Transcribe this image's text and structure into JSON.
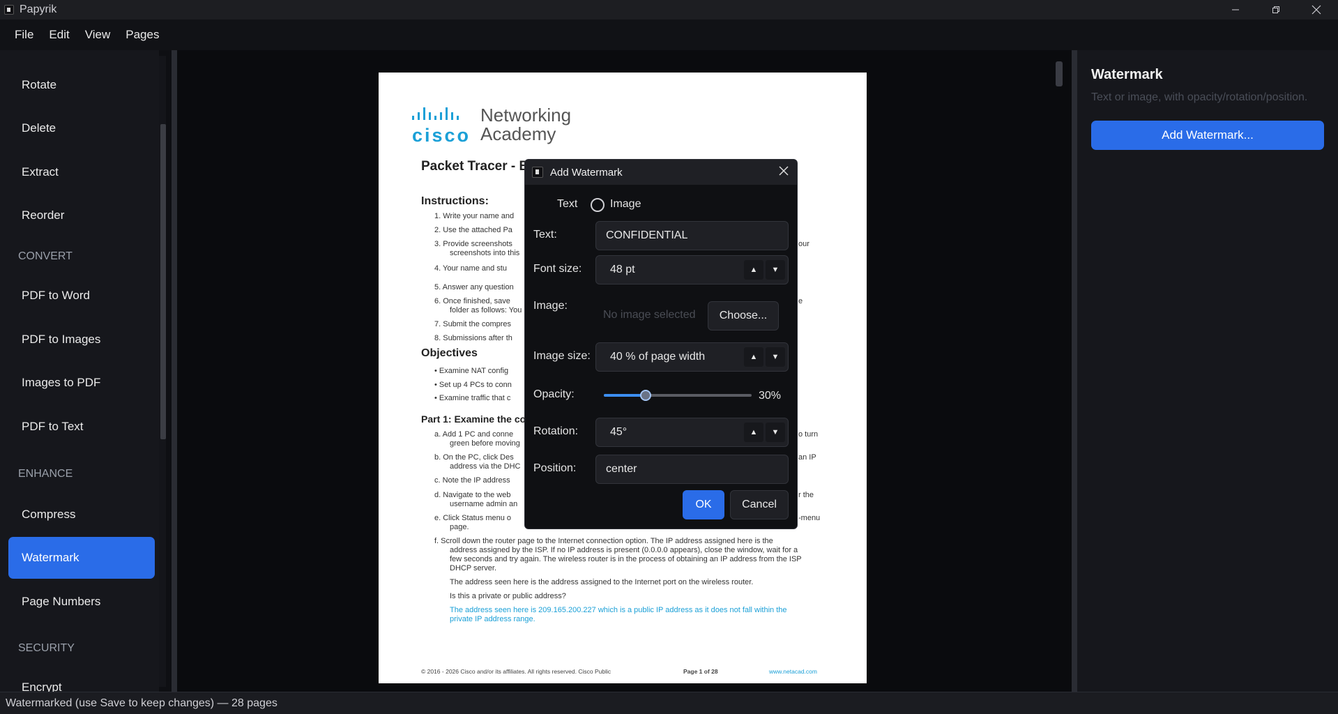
{
  "window": {
    "title": "Papyrik"
  },
  "menu": [
    "File",
    "Edit",
    "View",
    "Pages"
  ],
  "sidebar": {
    "items": [
      {
        "label": "Rotate"
      },
      {
        "label": "Delete"
      },
      {
        "label": "Extract"
      },
      {
        "label": "Reorder"
      },
      {
        "label": "PDF to Word"
      },
      {
        "label": "PDF to Images"
      },
      {
        "label": "Images to PDF"
      },
      {
        "label": "PDF to Text"
      },
      {
        "label": "Compress"
      },
      {
        "label": "Watermark",
        "active": true
      },
      {
        "label": "Page Numbers"
      },
      {
        "label": "Encrypt"
      }
    ],
    "headers": [
      "CONVERT",
      "ENHANCE",
      "SECURITY"
    ]
  },
  "right_panel": {
    "title": "Watermark",
    "subtitle": "Text or image, with opacity/rotation/position.",
    "button": "Add Watermark..."
  },
  "document": {
    "logo_top": "Networking",
    "logo_bottom": "Academy",
    "logo_cisco": "cisco",
    "title": "Packet Tracer - E",
    "instructions_heading": "Instructions:",
    "instructions": [
      "1.   Write your name and",
      "2.   Use the attached Pa",
      "3.   Provide screenshots",
      "screenshots into this",
      "4.   Your name and stu",
      "5.   Answer any question",
      "6.   Once finished, save",
      "folder as follows: You",
      "7.   Submit the compres",
      "8.   Submissions after th"
    ],
    "instr_tail": [
      "our",
      "e"
    ],
    "objectives_heading": "Objectives",
    "objectives": [
      "•   Examine NAT config",
      "•   Set up 4 PCs to conn",
      "•   Examine traffic that c"
    ],
    "part1_heading": "Part 1: Examine the co",
    "part1": [
      "a.   Add 1 PC and conne",
      "green before moving",
      "b.   On the PC, click Des",
      "address via the DHC",
      "c.   Note the IP address",
      "d.   Navigate to the web",
      "username admin an",
      "e.   Click Status menu o",
      "page."
    ],
    "part1_tail": [
      "o turn",
      "an IP",
      "r the",
      "-menu"
    ],
    "para_f": [
      "f.    Scroll down the router page to the Internet connection option. The IP address assigned here is the",
      "address assigned by the ISP. If no IP address is present (0.0.0.0 appears), close the window, wait for a",
      "few seconds and try again. The wireless router is in the process of obtaining an IP address from the ISP",
      "DHCP server."
    ],
    "para_g": "The address seen here is the address assigned to the Internet port on the wireless router.",
    "question": "Is this a private or public address?",
    "answer": [
      "The address seen here is 209.165.200.227 which is a public IP address as it does not fall within the",
      "private IP address range."
    ],
    "footer_left": "© 2016 - 2026 Cisco and/or its affiliates. All rights reserved. Cisco Public",
    "footer_page": "Page 1 of 28",
    "footer_right": "www.netacad.com"
  },
  "dialog": {
    "title": "Add Watermark",
    "mode_text": "Text",
    "mode_image": "Image",
    "text_label": "Text:",
    "text_value": "CONFIDENTIAL",
    "font_size_label": "Font size:",
    "font_size_value": "48 pt",
    "image_label": "Image:",
    "image_placeholder": "No image selected",
    "choose_label": "Choose...",
    "image_size_label": "Image size:",
    "image_size_value": "40 % of page width",
    "opacity_label": "Opacity:",
    "opacity_value": "30%",
    "opacity_fraction": 0.3,
    "rotation_label": "Rotation:",
    "rotation_value": "45°",
    "position_label": "Position:",
    "position_value": "center",
    "ok_label": "OK",
    "cancel_label": "Cancel"
  },
  "status": "Watermarked (use Save to keep changes) — 28 pages",
  "colors": {
    "accent": "#2a6ce8",
    "background": "#0e0f13",
    "panel": "#16171c"
  }
}
